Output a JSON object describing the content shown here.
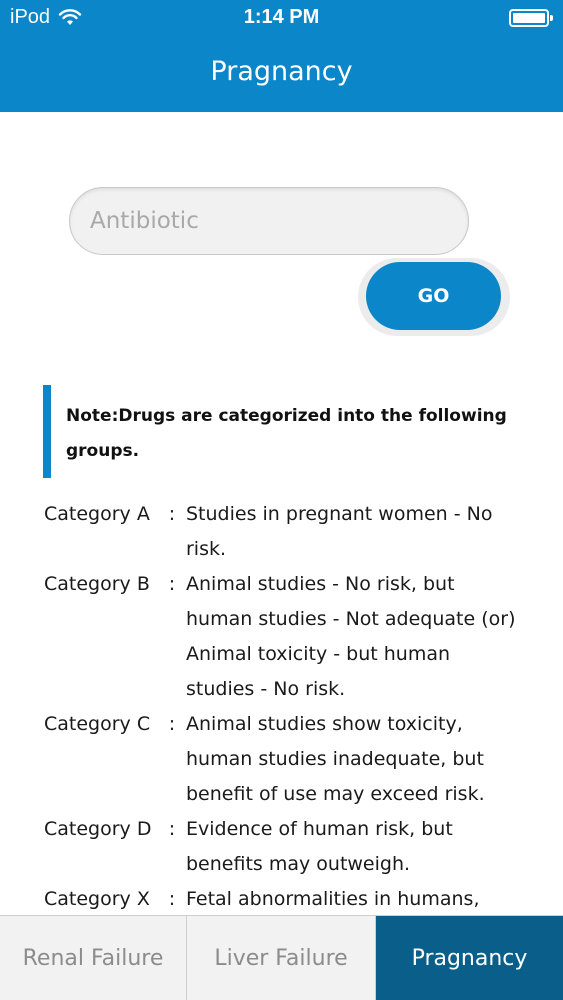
{
  "status_bar": {
    "carrier": "iPod",
    "time": "1:14 PM"
  },
  "header": {
    "title": "Pragnancy"
  },
  "search": {
    "placeholder": "Antibiotic",
    "value": ""
  },
  "go_button": {
    "label": "GO"
  },
  "note": {
    "text": "Note:Drugs are categorized into the following groups."
  },
  "categories": [
    {
      "label": "Category A",
      "separator": ":",
      "description": "Studies in pregnant women - No\nrisk."
    },
    {
      "label": "Category B",
      "separator": ":",
      "description": "Animal studies - No risk, but\nhuman studies - Not adequate (or)\nAnimal toxicity - but human\nstudies - No risk."
    },
    {
      "label": "Category C",
      "separator": ":",
      "description": "Animal studies show toxicity,\nhuman studies inadequate, but\nbenefit of use may exceed risk."
    },
    {
      "label": "Category D",
      "separator": ":",
      "description": "Evidence of human risk, but\nbenefits may outweigh."
    },
    {
      "label": "Category X",
      "separator": ":",
      "description": "Fetal abnormalities in humans,"
    }
  ],
  "tabs": [
    {
      "label": "Renal Failure",
      "active": false
    },
    {
      "label": "Liver Failure",
      "active": false
    },
    {
      "label": "Pragnancy",
      "active": true
    }
  ],
  "colors": {
    "accent": "#0a86c9",
    "active_tab": "#0a5f8a",
    "tab_bg": "#f2f2f2"
  },
  "icons": [
    "wifi-icon",
    "battery-icon"
  ]
}
